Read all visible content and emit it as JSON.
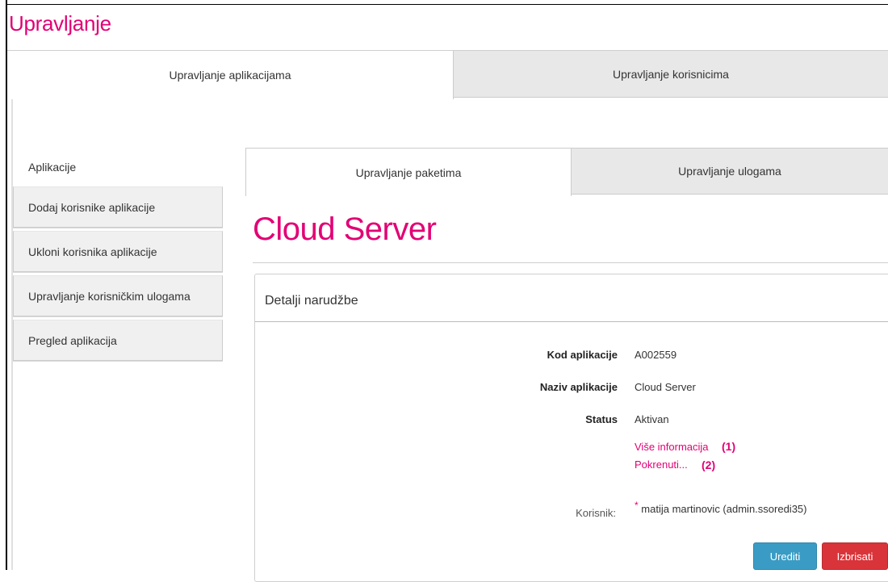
{
  "header": {
    "title": "Upravljanje"
  },
  "top_tabs": [
    {
      "label": "Upravljanje aplikacijama",
      "active": true
    },
    {
      "label": "Upravljanje korisnicima",
      "active": false
    }
  ],
  "sidebar": {
    "title": "Aplikacije",
    "items": [
      {
        "label": "Dodaj korisnike aplikacije"
      },
      {
        "label": "Ukloni korisnika aplikacije"
      },
      {
        "label": "Upravljanje korisničkim ulogama"
      },
      {
        "label": "Pregled aplikacija"
      }
    ]
  },
  "sub_tabs": [
    {
      "label": "Upravljanje paketima",
      "active": true
    },
    {
      "label": "Upravljanje ulogama",
      "active": false
    }
  ],
  "main": {
    "title": "Cloud Server",
    "panel_title": "Detalji narudžbe",
    "fields": [
      {
        "label": "Kod aplikacije",
        "value": "A002559"
      },
      {
        "label": "Naziv aplikacije",
        "value": "Cloud Server"
      },
      {
        "label": "Status",
        "value": "Aktivan"
      }
    ],
    "links": [
      {
        "label": "Više informacija",
        "annotation": "(1)"
      },
      {
        "label": "Pokrenuti...",
        "annotation": "(2)"
      }
    ],
    "korisnik": {
      "label": "Korisnik:",
      "required_mark": "*",
      "value": "matija martinovic (admin.ssoredi35)"
    }
  },
  "buttons": {
    "edit": "Urediti",
    "delete": "Izbrisati"
  },
  "colors": {
    "brand": "#e20074",
    "edit_button": "#3a9cc5",
    "delete_button": "#d9343a"
  }
}
